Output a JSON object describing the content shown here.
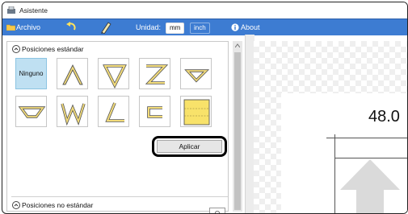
{
  "window": {
    "title": "Asistente"
  },
  "menubar": {
    "archivo_label": "Archivo",
    "unidad_label": "Unidad:",
    "units": [
      {
        "label": "mm",
        "selected": true
      },
      {
        "label": "inch",
        "selected": false
      }
    ],
    "about_label": "About"
  },
  "positions": {
    "standard_header": "Posiciones estándar",
    "tiles": [
      {
        "icon": "none",
        "label": "Ninguno",
        "selected": true
      },
      {
        "icon": "lambda-shape-icon",
        "label": "",
        "selected": false
      },
      {
        "icon": "flag-tilted-shape-icon",
        "label": "",
        "selected": false
      },
      {
        "icon": "z-shape-icon",
        "label": "",
        "selected": false
      },
      {
        "icon": "down-triangle-shape-icon",
        "label": "",
        "selected": false
      },
      {
        "icon": "left-chevron-shape-icon",
        "label": "",
        "selected": false
      },
      {
        "icon": "w-shape-icon",
        "label": "",
        "selected": false
      },
      {
        "icon": "l-slant-shape-icon",
        "label": "",
        "selected": false
      },
      {
        "icon": "c-shape-icon",
        "label": "",
        "selected": false
      },
      {
        "icon": "yellow-square-shape-icon",
        "label": "",
        "selected": false
      }
    ],
    "apply_label": "Aplicar",
    "nonstandard_header": "Posiciones no estándar"
  },
  "preview": {
    "dimension_value": "48.0"
  },
  "colors": {
    "menubar_bg": "#3d7cd2",
    "selected_tile": "#bfe0f2",
    "shape_fill": "#f3dc7a",
    "shape_stroke": "#555555"
  }
}
